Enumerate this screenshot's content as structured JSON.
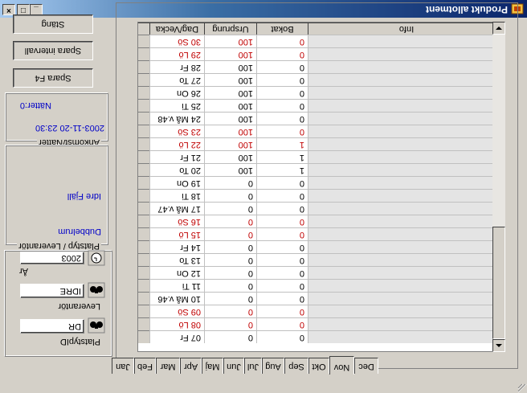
{
  "window": {
    "title": "Produkt allotment",
    "minimize": "_",
    "maximize": "□",
    "close": "×"
  },
  "buttons": {
    "close": "Stäng",
    "save_interval": "Spara intervall",
    "save_f4": "Spara F4"
  },
  "arrivals": {
    "group_label": "Ankomst/Nätter",
    "datetime": "2003-11-20 23:30",
    "nights": "Nätter:0"
  },
  "room_supplier": {
    "group_label": "Platstyp / Leverantör",
    "room_type": "Dubbelrum",
    "supplier": "Idre Fjäll"
  },
  "filters": {
    "room_type_label": "PlatstypID",
    "room_type_value": "DR",
    "supplier_label": "Leverantör",
    "supplier_value": "IDRE",
    "year_label": "År",
    "year_value": "2003"
  },
  "grid": {
    "columns": [
      "Dag/Vecka",
      "Ursprung",
      "Bokat",
      "Info"
    ],
    "rows": [
      {
        "day": "30 Sö",
        "origin": "100",
        "booked": "0",
        "red": true
      },
      {
        "day": "29 Lö",
        "origin": "100",
        "booked": "0",
        "red": true
      },
      {
        "day": "28 Fr",
        "origin": "100",
        "booked": "0",
        "red": false
      },
      {
        "day": "27 To",
        "origin": "100",
        "booked": "0",
        "red": false
      },
      {
        "day": "26 On",
        "origin": "100",
        "booked": "0",
        "red": false
      },
      {
        "day": "25 Ti",
        "origin": "100",
        "booked": "0",
        "red": false
      },
      {
        "day": "24 Må v.48",
        "origin": "100",
        "booked": "0",
        "red": false
      },
      {
        "day": "23 Sö",
        "origin": "100",
        "booked": "0",
        "red": true
      },
      {
        "day": "22 Lö",
        "origin": "100",
        "booked": "1",
        "red": true
      },
      {
        "day": "21 Fr",
        "origin": "100",
        "booked": "1",
        "red": false
      },
      {
        "day": "20 To",
        "origin": "100",
        "booked": "1",
        "red": false
      },
      {
        "day": "19 On",
        "origin": "0",
        "booked": "0",
        "red": false
      },
      {
        "day": "18 Ti",
        "origin": "0",
        "booked": "0",
        "red": false
      },
      {
        "day": "17 Må v.47",
        "origin": "0",
        "booked": "0",
        "red": false
      },
      {
        "day": "16 Sö",
        "origin": "0",
        "booked": "0",
        "red": true
      },
      {
        "day": "15 Lö",
        "origin": "0",
        "booked": "0",
        "red": true
      },
      {
        "day": "14 Fr",
        "origin": "0",
        "booked": "0",
        "red": false
      },
      {
        "day": "13 To",
        "origin": "0",
        "booked": "0",
        "red": false
      },
      {
        "day": "12 On",
        "origin": "0",
        "booked": "0",
        "red": false
      },
      {
        "day": "11 Ti",
        "origin": "0",
        "booked": "0",
        "red": false
      },
      {
        "day": "10 Må v.46",
        "origin": "0",
        "booked": "0",
        "red": false
      },
      {
        "day": "09 Sö",
        "origin": "0",
        "booked": "0",
        "red": true
      },
      {
        "day": "08 Lö",
        "origin": "0",
        "booked": "0",
        "red": true
      },
      {
        "day": "07 Fr",
        "origin": "0",
        "booked": "0",
        "red": false
      }
    ]
  },
  "tabs": [
    "Jan",
    "Feb",
    "Mar",
    "Apr",
    "Maj",
    "Jun",
    "Jul",
    "Aug",
    "Sep",
    "Okt",
    "Nov",
    "Dec"
  ],
  "active_tab": "Nov",
  "colors": {
    "weekend_text": "#c00000",
    "info_text": "#0000c8",
    "titlebar": "#0a246a"
  }
}
